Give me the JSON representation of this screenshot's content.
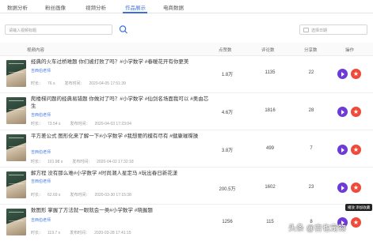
{
  "tabs": [
    {
      "label": "数据分析"
    },
    {
      "label": "粉丝画像"
    },
    {
      "label": "视频分析"
    },
    {
      "label": "作品展示",
      "active": true
    },
    {
      "label": "电商数据"
    }
  ],
  "search": {
    "placeholder": "请输入视频标题"
  },
  "date_filter": {
    "placeholder": "选择日期"
  },
  "columns": {
    "video": "视频内容",
    "likes": "点赞数",
    "comments": "评论数",
    "shares": "分享数",
    "actions": "操作"
  },
  "meta_labels": {
    "duration": "时长：",
    "published": "发布时间："
  },
  "rows": [
    {
      "title": "经典的火车过桥难题 你们被打败了吗？#小学数学 #春暖花开有你更美",
      "author": "吉西伯老师",
      "duration": "76 s",
      "published": "2020-04-05 17:51:39",
      "likes": "1.8万",
      "comments": "1135",
      "shares": "22"
    },
    {
      "title": "爬楼梯问题的经典易错题 你做对了吗？#小学数学 #仙剑名场面我可以 #奥由芯生",
      "author": "吉西伯老师",
      "duration": "73.54 s",
      "published": "2020-04-03 17:23:04",
      "likes": "4.6万",
      "comments": "1816",
      "shares": "28"
    },
    {
      "title": "平方差公式 图形化来了解一下#小学数学 #我想要的模有尽有 #健康璀璨操",
      "author": "吉西伯老师",
      "duration": "101.98 s",
      "published": "2020-04-02 17:32:18",
      "likes": "3.8万",
      "comments": "499",
      "shares": "7"
    },
    {
      "title": "解方程 没有那么难#小学数学 #时尚潮人星定马 #玩出春日新花漾",
      "author": "吉西伯老师",
      "duration": "62.69 s",
      "published": "2020-03-30 17:15:38",
      "likes": "200.5万",
      "comments": "1602",
      "shares": "23"
    },
    {
      "title": "数图形 掌握了方法就一眼就会一类#小学数学 #晓握题",
      "author": "吉西伯老师",
      "duration": "119.7 s",
      "published": "2020-03-28 17:41:15",
      "likes": "1256",
      "comments": "115",
      "shares": "8"
    }
  ],
  "tooltip": {
    "play": "播放",
    "favorite": "添加收藏"
  },
  "watermark": "头条 @吉也宠物",
  "colors": {
    "accent": "#3b6fe0",
    "play": "#6c3bd9",
    "favorite": "#ee4b3a",
    "author": "#4a7de0"
  }
}
